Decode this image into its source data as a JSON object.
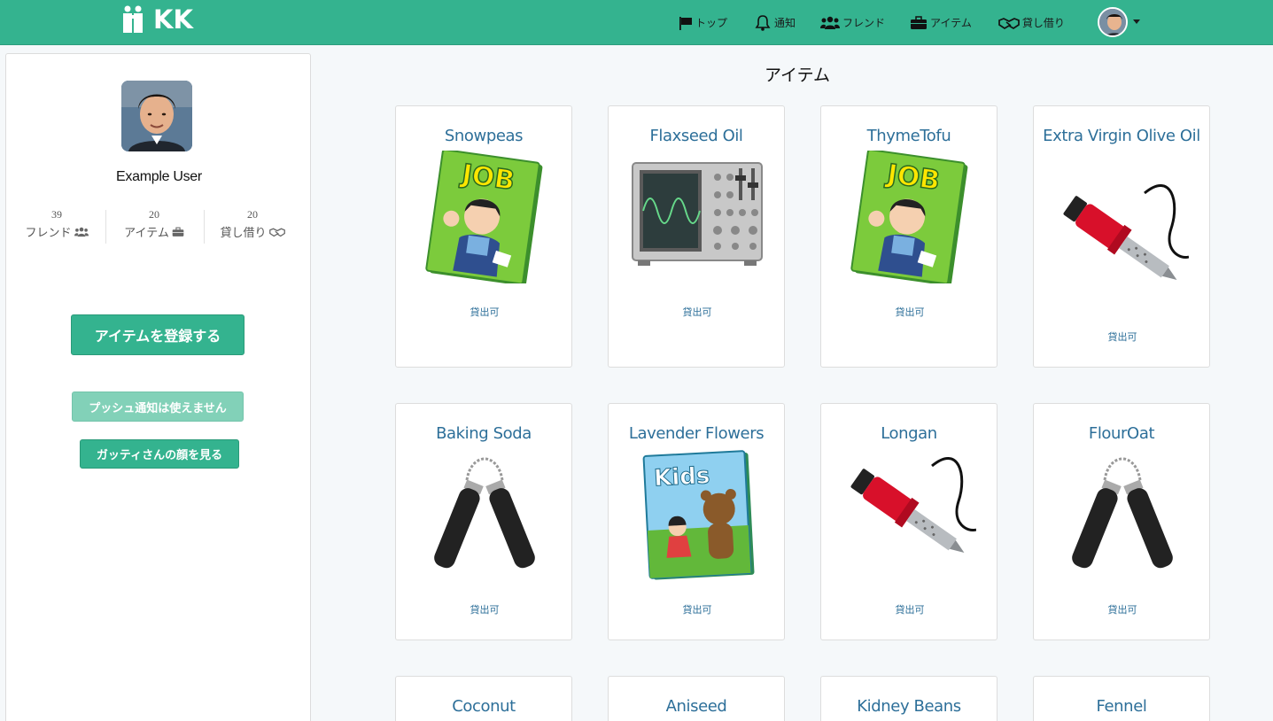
{
  "app": {
    "logo_text": "KK"
  },
  "nav": {
    "items": [
      {
        "label": "トップ",
        "icon": "flag-icon"
      },
      {
        "label": "通知",
        "icon": "bell-icon"
      },
      {
        "label": "フレンド",
        "icon": "users-icon"
      },
      {
        "label": "アイテム",
        "icon": "briefcase-icon"
      },
      {
        "label": "貸し借り",
        "icon": "handshake-icon"
      }
    ]
  },
  "profile": {
    "name": "Example User",
    "stats": [
      {
        "count": "39",
        "label": "フレンド",
        "icon": "users-icon"
      },
      {
        "count": "20",
        "label": "アイテム",
        "icon": "briefcase-icon"
      },
      {
        "count": "20",
        "label": "貸し借り",
        "icon": "handshake-icon"
      }
    ],
    "buttons": {
      "register": "アイテムを登録する",
      "push": "プッシュ通知は使えません",
      "face": "ガッティさんの顔を見る"
    }
  },
  "main": {
    "title": "アイテム",
    "items": [
      {
        "name": "Snowpeas",
        "image": "job-magazine",
        "status": "貸出可"
      },
      {
        "name": "Flaxseed Oil",
        "image": "oscilloscope",
        "status": "貸出可"
      },
      {
        "name": "ThymeTofu",
        "image": "job-magazine",
        "status": "貸出可"
      },
      {
        "name": "Extra Virgin Olive Oil",
        "image": "soldering-iron",
        "status": "貸出可"
      },
      {
        "name": "Baking Soda",
        "image": "nunchaku",
        "status": "貸出可"
      },
      {
        "name": "Lavender Flowers",
        "image": "kids-book",
        "status": "貸出可"
      },
      {
        "name": "Longan",
        "image": "soldering-iron",
        "status": "貸出可"
      },
      {
        "name": "FlourOat",
        "image": "nunchaku",
        "status": "貸出可"
      },
      {
        "name": "Coconut",
        "image": "",
        "status": ""
      },
      {
        "name": "Aniseed",
        "image": "",
        "status": ""
      },
      {
        "name": "Kidney Beans",
        "image": "",
        "status": ""
      },
      {
        "name": "Fennel",
        "image": "",
        "status": ""
      }
    ],
    "job_cover_text": "JOB",
    "kids_cover_text": "Kids"
  },
  "colors": {
    "brand": "#34b38f",
    "link": "#2d6f99"
  }
}
